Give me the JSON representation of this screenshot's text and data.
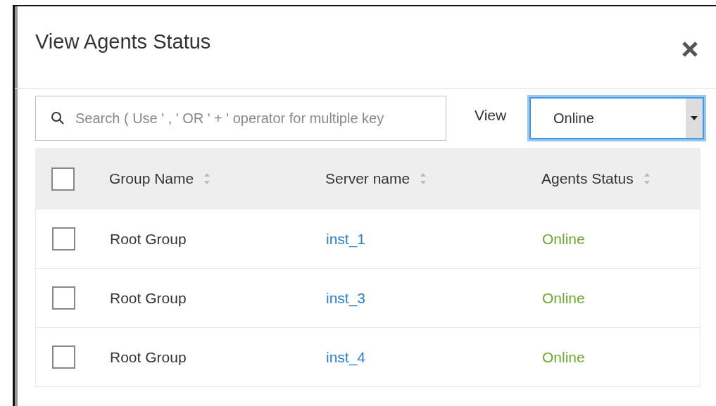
{
  "dialog": {
    "title": "View Agents Status"
  },
  "search": {
    "placeholder": "Search ( Use ' , ' OR ' + ' operator for multiple key"
  },
  "view_filter": {
    "label": "View",
    "value": "Online"
  },
  "table": {
    "columns": [
      {
        "label": "Group Name"
      },
      {
        "label": "Server name"
      },
      {
        "label": "Agents Status"
      }
    ],
    "header_checked": false,
    "rows": [
      {
        "checked": false,
        "group": "Root Group",
        "server": "inst_1",
        "status": "Online",
        "color": "#6aab2e"
      },
      {
        "checked": false,
        "group": "Root Group",
        "server": "inst_3",
        "status": "Online",
        "color": "#6aab2e"
      },
      {
        "checked": false,
        "group": "Root Group",
        "server": "inst_4",
        "status": "Online",
        "color": "#6aab2e"
      }
    ]
  }
}
